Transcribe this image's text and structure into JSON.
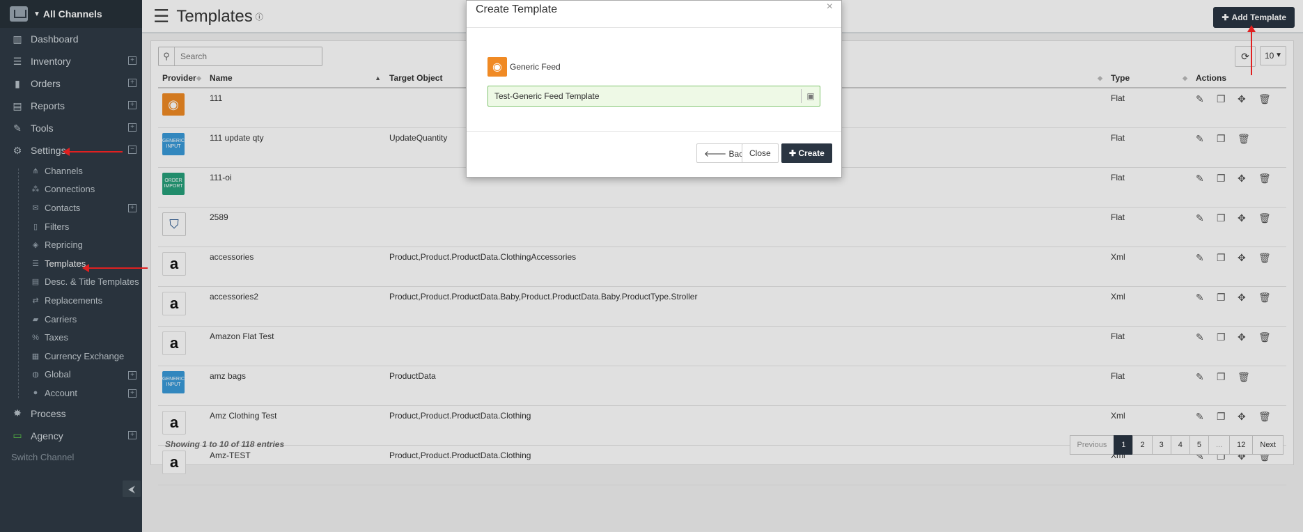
{
  "sidebar": {
    "header": "All Channels",
    "items": [
      {
        "label": "Dashboard",
        "icon": "chart-icon"
      },
      {
        "label": "Inventory",
        "icon": "list-icon",
        "expandable": true
      },
      {
        "label": "Orders",
        "icon": "bars-icon",
        "expandable": true
      },
      {
        "label": "Reports",
        "icon": "report-icon",
        "expandable": true
      },
      {
        "label": "Tools",
        "icon": "wrench-icon",
        "expandable": true
      },
      {
        "label": "Settings",
        "icon": "gear-icon",
        "expandable": true,
        "expanded": true
      }
    ],
    "settings_sub": [
      {
        "label": "Channels",
        "icon": "channels-icon"
      },
      {
        "label": "Connections",
        "icon": "connections-icon"
      },
      {
        "label": "Contacts",
        "icon": "envelope-icon",
        "expandable": true
      },
      {
        "label": "Filters",
        "icon": "file-icon"
      },
      {
        "label": "Repricing",
        "icon": "tag-icon"
      },
      {
        "label": "Templates",
        "icon": "list-icon",
        "active": true
      },
      {
        "label": "Desc. & Title Templates",
        "icon": "doc-icon"
      },
      {
        "label": "Replacements",
        "icon": "swap-icon"
      },
      {
        "label": "Carriers",
        "icon": "truck-icon"
      },
      {
        "label": "Taxes",
        "icon": "percent-icon"
      },
      {
        "label": "Currency Exchange",
        "icon": "money-icon"
      },
      {
        "label": "Global",
        "icon": "globe-icon",
        "expandable": true
      },
      {
        "label": "Account",
        "icon": "user-icon",
        "expandable": true
      }
    ],
    "bottom": [
      {
        "label": "Process",
        "icon": "process-icon"
      },
      {
        "label": "Agency",
        "icon": "monitor-icon",
        "expandable": true
      }
    ],
    "switch_channel": "Switch Channel"
  },
  "header": {
    "title": "Templates",
    "add_button": "Add Template"
  },
  "table": {
    "search_placeholder": "Search",
    "per_page": "10",
    "columns": [
      "Provider",
      "Name",
      "Target Object",
      "Type",
      "Actions"
    ],
    "rows": [
      {
        "provider": "rss",
        "name": "111",
        "target": "",
        "type": "Flat",
        "actions": 4
      },
      {
        "provider": "generic",
        "name": "111 update qty",
        "target": "UpdateQuantity",
        "type": "Flat",
        "actions": 3
      },
      {
        "provider": "order",
        "name": "111-oi",
        "target": "",
        "type": "Flat",
        "actions": 4
      },
      {
        "provider": "shield",
        "name": "2589",
        "target": "",
        "type": "Flat",
        "actions": 4
      },
      {
        "provider": "amazon",
        "name": "accessories",
        "target": "Product,Product.ProductData.ClothingAccessories",
        "type": "Xml",
        "actions": 4
      },
      {
        "provider": "amazon",
        "name": "accessories2",
        "target": "Product,Product.ProductData.Baby,Product.ProductData.Baby.ProductType.Stroller",
        "type": "Xml",
        "actions": 4
      },
      {
        "provider": "amazon",
        "name": "Amazon Flat Test",
        "target": "",
        "type": "Flat",
        "actions": 4
      },
      {
        "provider": "generic",
        "name": "amz bags",
        "target": "ProductData",
        "type": "Flat",
        "actions": 3
      },
      {
        "provider": "amazon",
        "name": "Amz Clothing Test",
        "target": "Product,Product.ProductData.Clothing",
        "type": "Xml",
        "actions": 4
      },
      {
        "provider": "amazon",
        "name": "Amz-TEST",
        "target": "Product,Product.ProductData.Clothing",
        "type": "Xml",
        "actions": 4
      }
    ],
    "logo_text": {
      "generic": "GENERIC INPUT",
      "order": "ORDER IMPORT",
      "amazon": "a"
    },
    "info": "Showing 1 to 10 of 118 entries",
    "pager": [
      "Previous",
      "1",
      "2",
      "3",
      "4",
      "5",
      "...",
      "12",
      "Next"
    ],
    "current_page": "1"
  },
  "modal": {
    "title": "Create Template",
    "close_x": "×",
    "provider_label": "Generic Feed",
    "template_name": "Test-Generic Feed Template",
    "back": "Back",
    "close": "Close",
    "create": "Create"
  }
}
